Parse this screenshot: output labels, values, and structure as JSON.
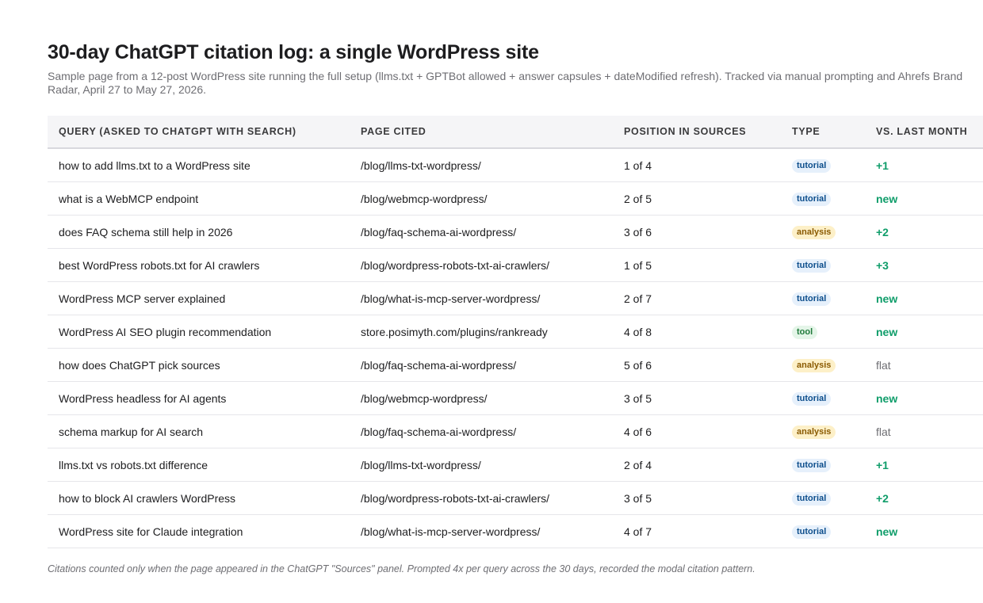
{
  "title": "30-day ChatGPT citation log: a single WordPress site",
  "subtitle_line1": "Sample page from a 12-post WordPress site running the full setup (llms.txt + GPTBot allowed + answer capsules + dateModified refresh). Tracked via manual prompting and Ahrefs Brand",
  "subtitle_line2": "Radar, April 27 to May 27, 2026.",
  "table": {
    "headers": {
      "query": "QUERY (ASKED TO CHATGPT WITH SEARCH)",
      "page": "PAGE CITED",
      "position": "POSITION IN SOURCES",
      "type": "TYPE",
      "trend": "VS. LAST MONTH"
    },
    "rows": [
      {
        "query": "how to add llms.txt to a WordPress site",
        "page": "/blog/llms-txt-wordpress/",
        "position": "1 of 4",
        "type": "tutorial",
        "trend": "+1"
      },
      {
        "query": "what is a WebMCP endpoint",
        "page": "/blog/webmcp-wordpress/",
        "position": "2 of 5",
        "type": "tutorial",
        "trend": "new"
      },
      {
        "query": "does FAQ schema still help in 2026",
        "page": "/blog/faq-schema-ai-wordpress/",
        "position": "3 of 6",
        "type": "analysis",
        "trend": "+2"
      },
      {
        "query": "best WordPress robots.txt for AI crawlers",
        "page": "/blog/wordpress-robots-txt-ai-crawlers/",
        "position": "1 of 5",
        "type": "tutorial",
        "trend": "+3"
      },
      {
        "query": "WordPress MCP server explained",
        "page": "/blog/what-is-mcp-server-wordpress/",
        "position": "2 of 7",
        "type": "tutorial",
        "trend": "new"
      },
      {
        "query": "WordPress AI SEO plugin recommendation",
        "page": "store.posimyth.com/plugins/rankready",
        "position": "4 of 8",
        "type": "tool",
        "trend": "new"
      },
      {
        "query": "how does ChatGPT pick sources",
        "page": "/blog/faq-schema-ai-wordpress/",
        "position": "5 of 6",
        "type": "analysis",
        "trend": "flat"
      },
      {
        "query": "WordPress headless for AI agents",
        "page": "/blog/webmcp-wordpress/",
        "position": "3 of 5",
        "type": "tutorial",
        "trend": "new"
      },
      {
        "query": "schema markup for AI search",
        "page": "/blog/faq-schema-ai-wordpress/",
        "position": "4 of 6",
        "type": "analysis",
        "trend": "flat"
      },
      {
        "query": "llms.txt vs robots.txt difference",
        "page": "/blog/llms-txt-wordpress/",
        "position": "2 of 4",
        "type": "tutorial",
        "trend": "+1"
      },
      {
        "query": "how to block AI crawlers WordPress",
        "page": "/blog/wordpress-robots-txt-ai-crawlers/",
        "position": "3 of 5",
        "type": "tutorial",
        "trend": "+2"
      },
      {
        "query": "WordPress site for Claude integration",
        "page": "/blog/what-is-mcp-server-wordpress/",
        "position": "4 of 7",
        "type": "tutorial",
        "trend": "new"
      }
    ]
  },
  "footnote": "Citations counted only when the page appeared in the ChatGPT \"Sources\" panel. Prompted 4x per query across the 30 days, recorded the modal citation pattern.",
  "colors": {
    "trend_positive": "#0f9d6a",
    "trend_flat": "#6e6e73",
    "badge_tutorial": "#e6f0fb",
    "badge_analysis": "#fdf0c8",
    "badge_tool": "#e4f5e8"
  }
}
